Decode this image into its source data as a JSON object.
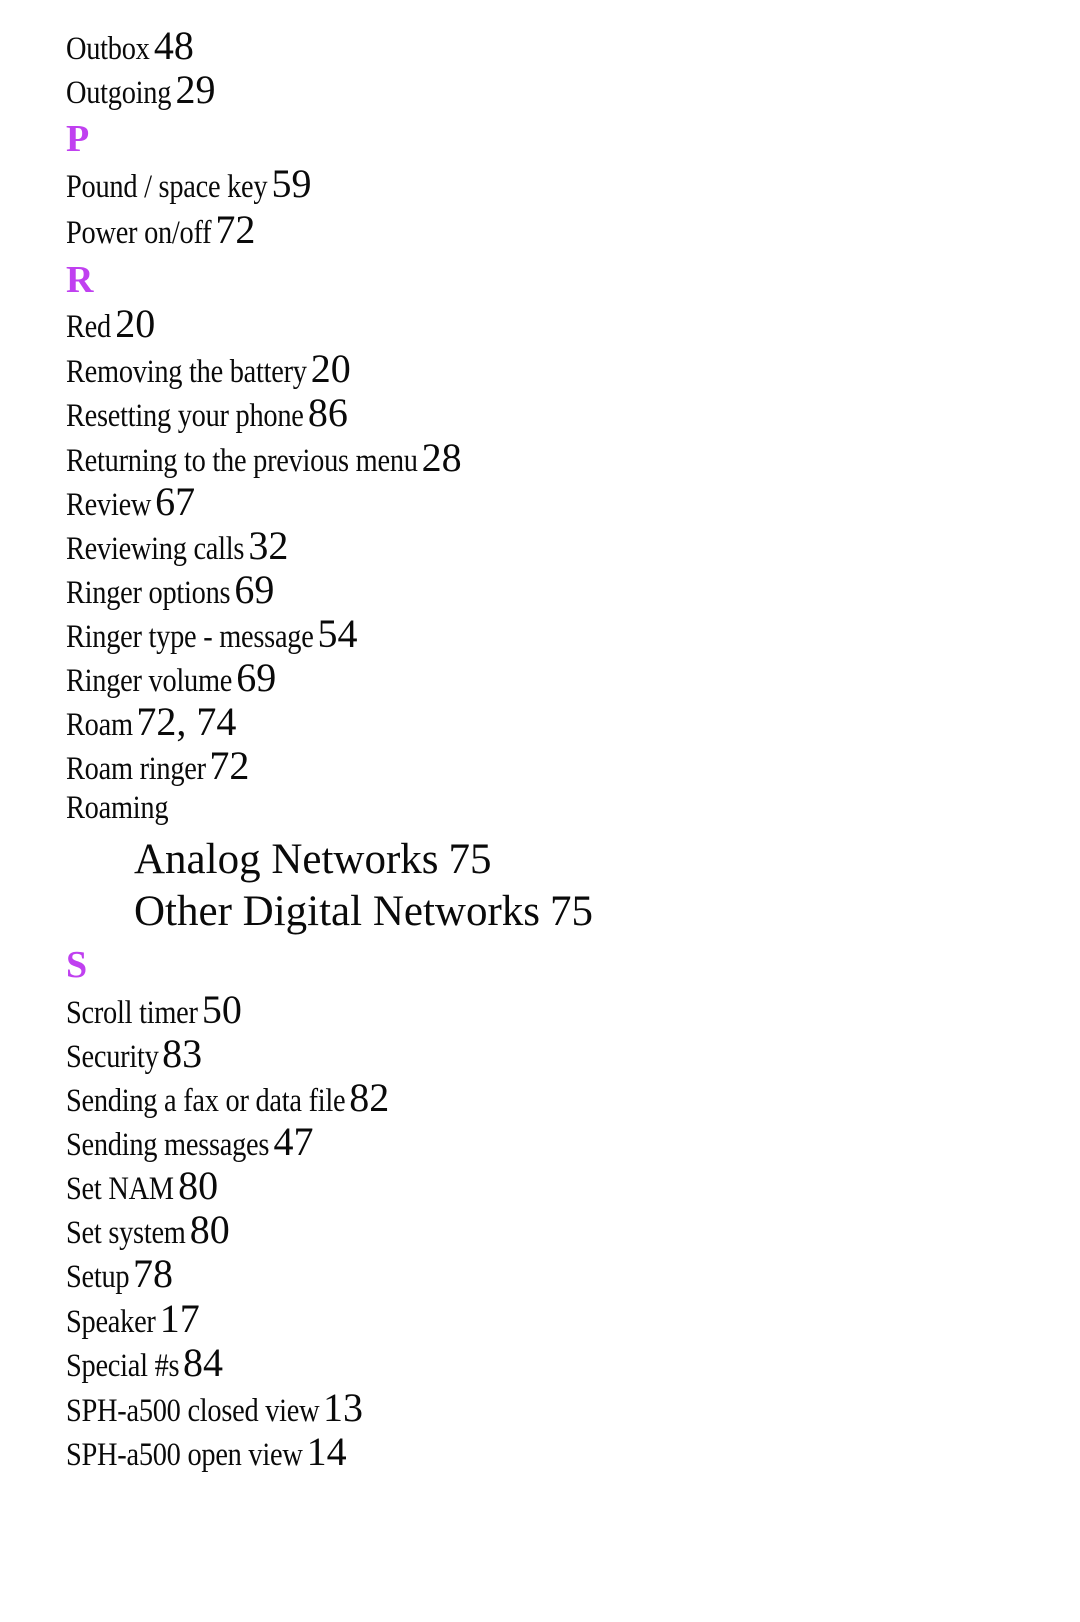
{
  "index": {
    "sections": [
      {
        "letter": null,
        "entries": [
          {
            "term": "Outbox",
            "pages": "48"
          },
          {
            "term": "Outgoing",
            "pages": "29"
          }
        ]
      },
      {
        "letter": "P",
        "entries": [
          {
            "term": "Pound / space key",
            "pages": "59"
          },
          {
            "term": "Power on/off",
            "pages": "72"
          }
        ]
      },
      {
        "letter": "R",
        "entries": [
          {
            "term": "Red",
            "pages": "20"
          },
          {
            "term": "Removing the battery",
            "pages": "20"
          },
          {
            "term": "Resetting your phone",
            "pages": "86"
          },
          {
            "term": "Returning to the previous menu",
            "pages": "28"
          },
          {
            "term": "Review",
            "pages": "67"
          },
          {
            "term": "Reviewing calls",
            "pages": "32"
          },
          {
            "term": "Ringer options",
            "pages": "69"
          },
          {
            "term": "Ringer type - message",
            "pages": "54"
          },
          {
            "term": "Ringer volume",
            "pages": "69"
          },
          {
            "term": "Roam",
            "pages": "72, 74"
          },
          {
            "term": "Roam ringer",
            "pages": "72"
          },
          {
            "term": "Roaming",
            "pages": "",
            "subentries": [
              {
                "term": "Analog Networks",
                "pages": "75"
              },
              {
                "term": "Other Digital Networks",
                "pages": "75"
              }
            ]
          }
        ]
      },
      {
        "letter": "S",
        "entries": [
          {
            "term": "Scroll timer",
            "pages": "50"
          },
          {
            "term": "Security",
            "pages": "83"
          },
          {
            "term": "Sending a fax or data file",
            "pages": "82"
          },
          {
            "term": "Sending messages",
            "pages": "47"
          },
          {
            "term": "Set NAM",
            "pages": "80"
          },
          {
            "term": "Set system",
            "pages": "80"
          },
          {
            "term": "Setup",
            "pages": "78"
          },
          {
            "term": "Speaker",
            "pages": "17"
          },
          {
            "term": "Special #s",
            "pages": "84"
          },
          {
            "term": "SPH-a500 closed view",
            "pages": "13"
          },
          {
            "term": "SPH-a500 open view",
            "pages": "14"
          }
        ]
      }
    ],
    "accent_color": "#c040f0"
  }
}
